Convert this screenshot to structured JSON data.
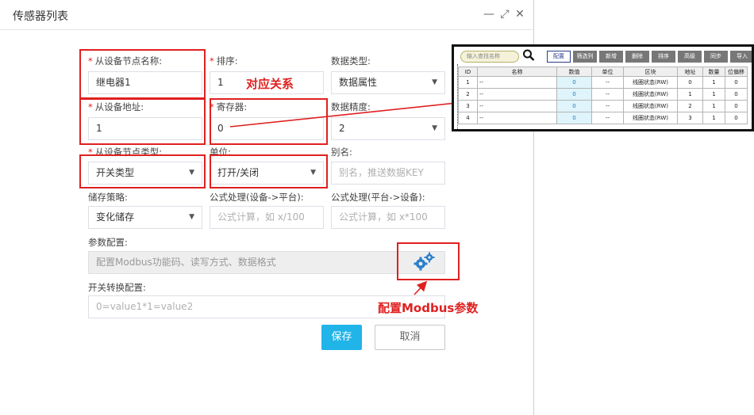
{
  "dialog": {
    "title": "传感器列表",
    "controls": [
      "—",
      "⤢",
      "✕"
    ]
  },
  "form": {
    "node_name": {
      "label": "从设备节点名称:",
      "value": "继电器1",
      "required": true
    },
    "sort": {
      "label": "排序:",
      "value": "1",
      "required": true
    },
    "data_type": {
      "label": "数据类型:",
      "value": "数据属性"
    },
    "address": {
      "label": "从设备地址:",
      "value": "1",
      "required": true
    },
    "register": {
      "label": "寄存器:",
      "value": "0",
      "required": true
    },
    "precision": {
      "label": "数据精度:",
      "value": "2"
    },
    "node_type": {
      "label": "从设备节点类型:",
      "value": "开关类型",
      "required": true
    },
    "unit": {
      "label": "单位:",
      "value": "打开/关闭"
    },
    "alias": {
      "label": "别名:",
      "placeholder": "别名，推送数据KEY"
    },
    "storage": {
      "label": "储存策略:",
      "value": "变化储存"
    },
    "formula_up": {
      "label": "公式处理(设备->平台):",
      "placeholder": "公式计算，如 x/100"
    },
    "formula_down": {
      "label": "公式处理(平台->设备):",
      "placeholder": "公式计算，如 x*100"
    },
    "param_config": {
      "label": "参数配置:",
      "placeholder": "配置Modbus功能码、读写方式、数据格式"
    },
    "switch_config": {
      "label": "开关转换配置:",
      "placeholder": "0=value1*1=value2"
    },
    "save_label": "保存",
    "cancel_label": "取消"
  },
  "annotations": {
    "mapping": "对应关系",
    "modbus": "配置Modbus参数"
  },
  "colors": {
    "accent": "#20b4e8",
    "annotation": "#e02020"
  },
  "table_panel": {
    "search_placeholder": "输入查找名称",
    "buttons": [
      "配置",
      "筛选列",
      "新增",
      "删除",
      "排序",
      "高级",
      "同步",
      "导入"
    ],
    "columns": [
      "ID",
      "名称",
      "数值",
      "单位",
      "区块",
      "地址",
      "数量",
      "位偏移"
    ],
    "rows": [
      [
        "1",
        "--",
        "0",
        "--",
        "线圈状态(RW)",
        "0",
        "1",
        "0"
      ],
      [
        "2",
        "--",
        "0",
        "--",
        "线圈状态(RW)",
        "1",
        "1",
        "0"
      ],
      [
        "3",
        "--",
        "0",
        "--",
        "线圈状态(RW)",
        "2",
        "1",
        "0"
      ],
      [
        "4",
        "--",
        "0",
        "--",
        "线圈状态(RW)",
        "3",
        "1",
        "0"
      ]
    ]
  }
}
